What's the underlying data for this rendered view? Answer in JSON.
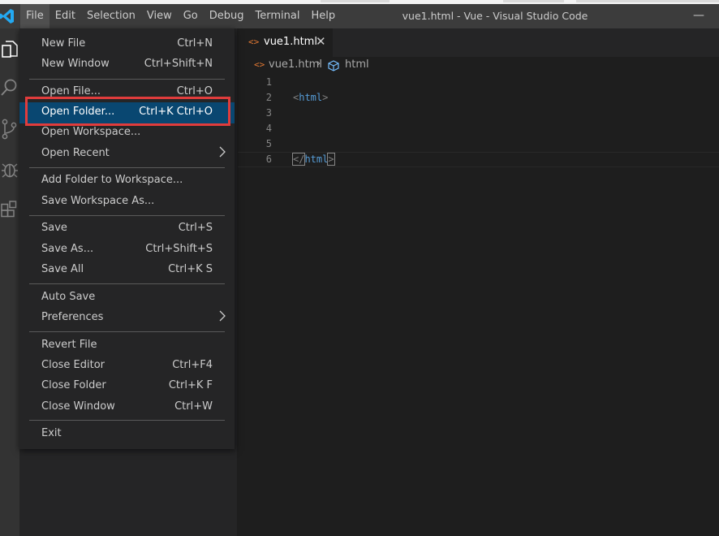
{
  "window": {
    "title": "vue1.html - Vue - Visual Studio Code",
    "minimize_glyph": "—"
  },
  "menubar": {
    "items": [
      "File",
      "Edit",
      "Selection",
      "View",
      "Go",
      "Debug",
      "Terminal",
      "Help"
    ],
    "active_index": 0
  },
  "activitybar": {
    "icons": [
      "explorer-icon",
      "search-icon",
      "source-control-icon",
      "debug-icon",
      "extensions-icon"
    ]
  },
  "tab": {
    "label": "vue1.html",
    "icon": "html-file-icon",
    "close_glyph": "✕"
  },
  "breadcrumb": {
    "file": "vue1.html",
    "separator": "›",
    "symbol": "html"
  },
  "editor": {
    "lines": [
      {
        "number": "1",
        "text": ""
      },
      {
        "number": "2",
        "open_bracket": "<",
        "tag": "html",
        "close_bracket": ">"
      },
      {
        "number": "3",
        "text": ""
      },
      {
        "number": "4",
        "text": ""
      },
      {
        "number": "5",
        "text": ""
      },
      {
        "number": "6",
        "open_bracket": "</",
        "tag": "html",
        "close_bracket": ">"
      }
    ],
    "current_line": 6
  },
  "file_menu": {
    "items": {
      "new_file": {
        "label": "New File",
        "shortcut": "Ctrl+N"
      },
      "new_window": {
        "label": "New Window",
        "shortcut": "Ctrl+Shift+N"
      },
      "open_file": {
        "label": "Open File...",
        "shortcut": "Ctrl+O"
      },
      "open_folder": {
        "label": "Open Folder...",
        "shortcut": "Ctrl+K Ctrl+O"
      },
      "open_workspace": {
        "label": "Open Workspace..."
      },
      "open_recent": {
        "label": "Open Recent"
      },
      "add_folder": {
        "label": "Add Folder to Workspace..."
      },
      "save_workspace_as": {
        "label": "Save Workspace As..."
      },
      "save": {
        "label": "Save",
        "shortcut": "Ctrl+S"
      },
      "save_as": {
        "label": "Save As...",
        "shortcut": "Ctrl+Shift+S"
      },
      "save_all": {
        "label": "Save All",
        "shortcut": "Ctrl+K S"
      },
      "auto_save": {
        "label": "Auto Save"
      },
      "preferences": {
        "label": "Preferences"
      },
      "revert_file": {
        "label": "Revert File"
      },
      "close_editor": {
        "label": "Close Editor",
        "shortcut": "Ctrl+F4"
      },
      "close_folder": {
        "label": "Close Folder",
        "shortcut": "Ctrl+K F"
      },
      "close_window": {
        "label": "Close Window",
        "shortcut": "Ctrl+W"
      },
      "exit": {
        "label": "Exit"
      }
    },
    "selected": "open_folder"
  },
  "colors": {
    "accent": "#094771",
    "highlight_box": "#e03c3c",
    "html_tag": "#569cd6",
    "html_file_icon": "#e37933",
    "vscode_logo": "#23a9f2"
  }
}
